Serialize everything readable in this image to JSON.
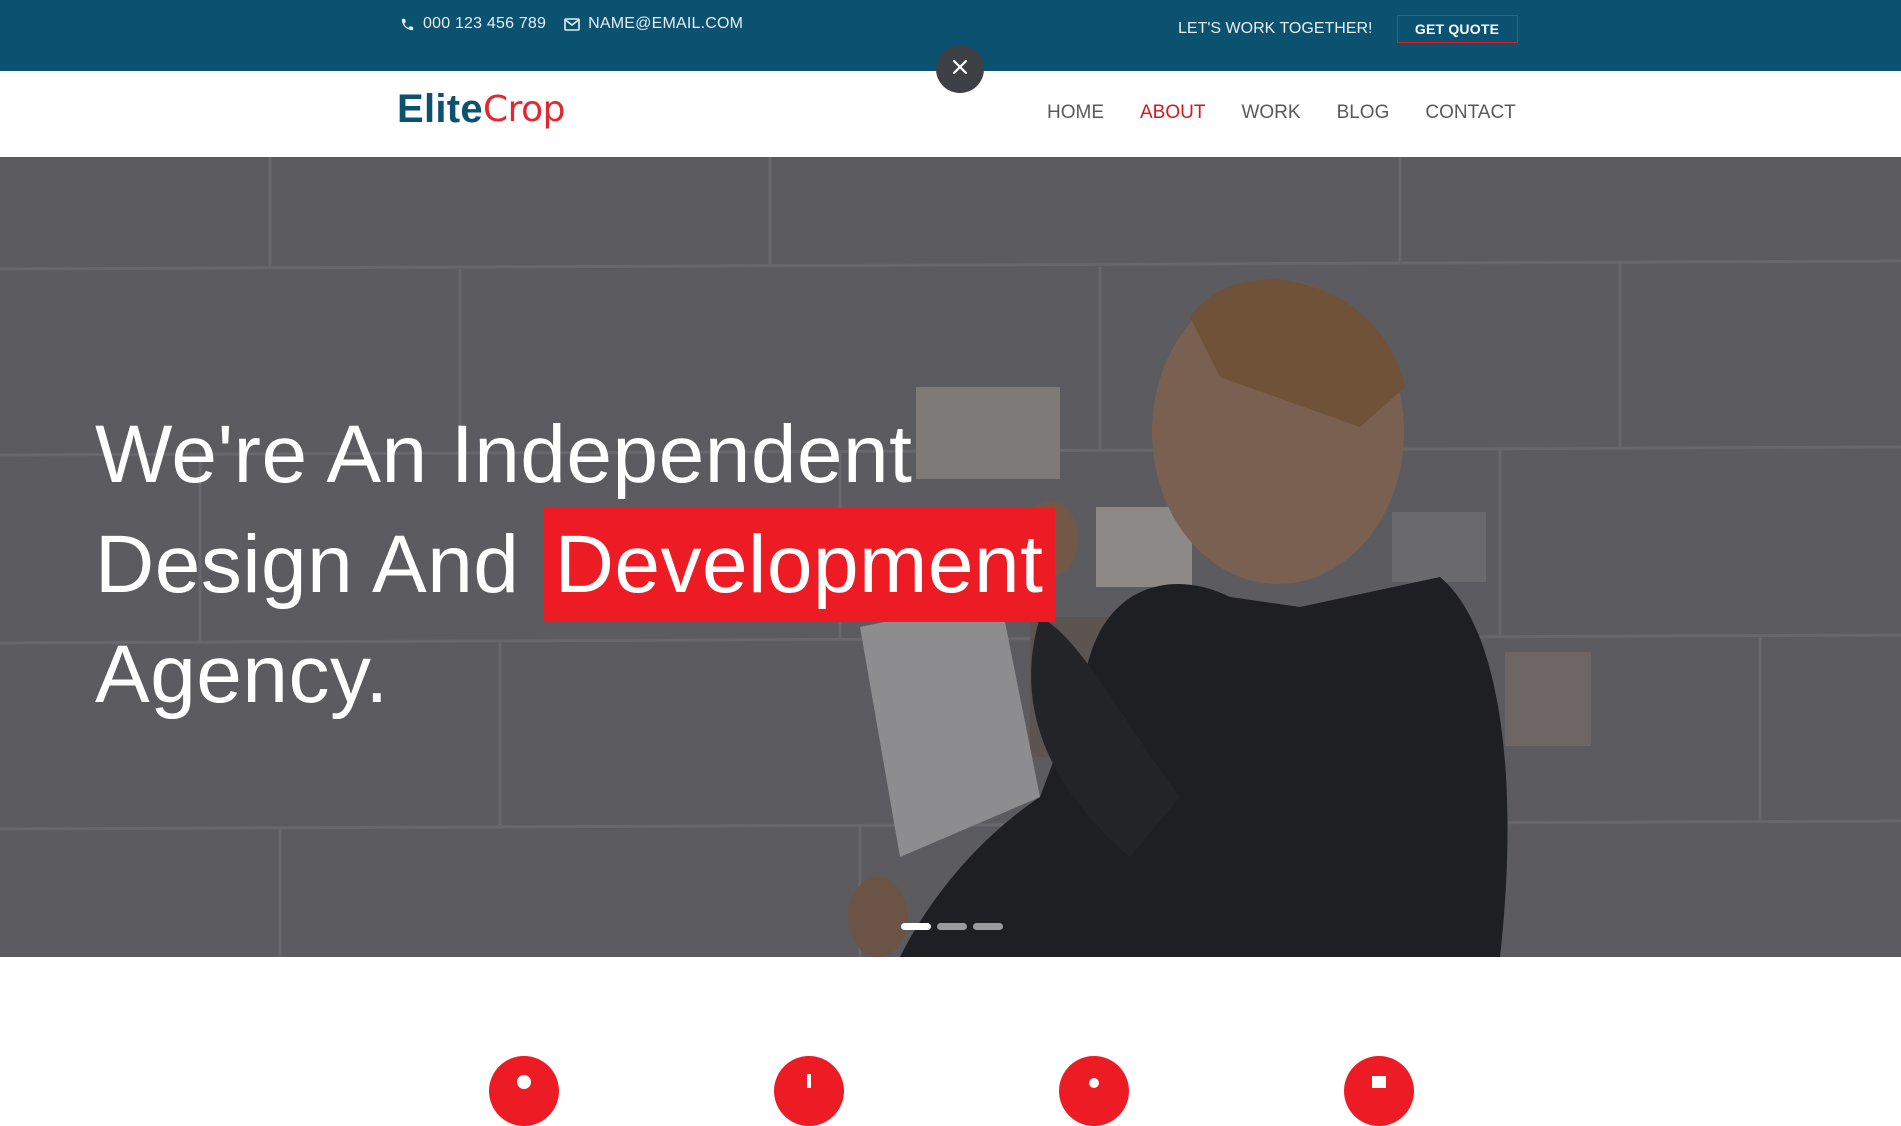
{
  "topbar": {
    "phone": "000 123 456 789",
    "email": "NAME@EMAIL.COM",
    "tagline": "LET'S WORK TOGETHER!",
    "quote_label": "GET QUOTE",
    "phone_icon": "phone-icon",
    "email_icon": "envelope-icon"
  },
  "close_icon": "close-icon",
  "header": {
    "logo_part1": "Elite",
    "logo_part2": "Crop",
    "nav": [
      {
        "label": "HOME",
        "active": false
      },
      {
        "label": "ABOUT",
        "active": true
      },
      {
        "label": "WORK",
        "active": false
      },
      {
        "label": "BLOG",
        "active": false
      },
      {
        "label": "CONTACT",
        "active": false
      }
    ]
  },
  "hero": {
    "line1": "We're An Independent",
    "line2_pre": "Design And ",
    "line2_highlight": "Development",
    "line3": "Agency.",
    "slides": 3,
    "active_slide": 1
  },
  "services": {
    "icons": [
      "service-icon-1",
      "service-icon-2",
      "service-icon-3",
      "service-icon-4"
    ]
  },
  "colors": {
    "topbar": "#0b5270",
    "accent": "#ed1c24",
    "nav_text": "#555a5f",
    "overlay": "#3d4146"
  }
}
